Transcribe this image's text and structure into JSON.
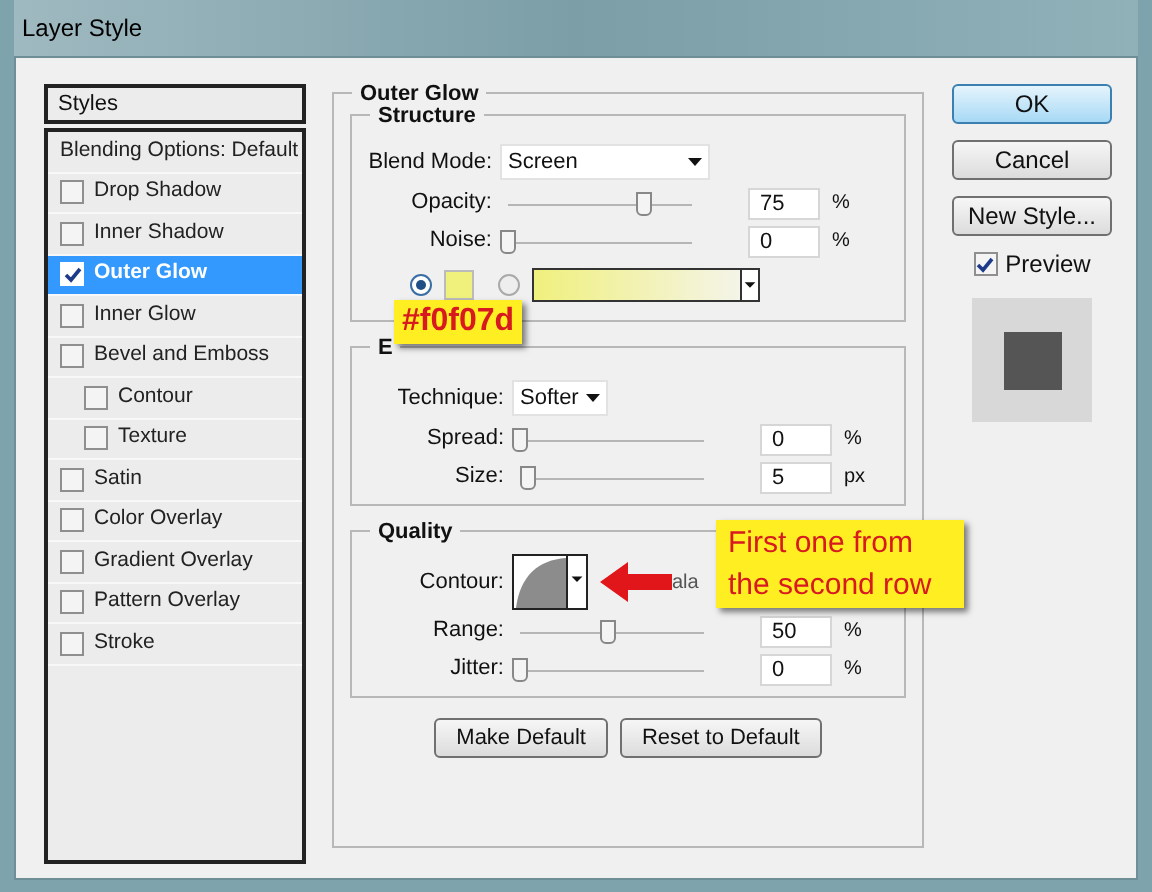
{
  "window": {
    "title": "Layer Style"
  },
  "styles_panel": {
    "header": "Styles",
    "items": [
      {
        "label": "Blending Options: Default",
        "kind": "plain",
        "selected": false
      },
      {
        "label": "Drop Shadow",
        "kind": "checkbox",
        "checked": false,
        "selected": false
      },
      {
        "label": "Inner Shadow",
        "kind": "checkbox",
        "checked": false,
        "selected": false
      },
      {
        "label": "Outer Glow",
        "kind": "checkbox",
        "checked": true,
        "selected": true
      },
      {
        "label": "Inner Glow",
        "kind": "checkbox",
        "checked": false,
        "selected": false
      },
      {
        "label": "Bevel and Emboss",
        "kind": "checkbox",
        "checked": false,
        "selected": false,
        "children": [
          {
            "label": "Contour",
            "kind": "checkbox",
            "checked": false,
            "selected": false
          },
          {
            "label": "Texture",
            "kind": "checkbox",
            "checked": false,
            "selected": false
          }
        ]
      },
      {
        "label": "Satin",
        "kind": "checkbox",
        "checked": false,
        "selected": false
      },
      {
        "label": "Color Overlay",
        "kind": "checkbox",
        "checked": false,
        "selected": false
      },
      {
        "label": "Gradient Overlay",
        "kind": "checkbox",
        "checked": false,
        "selected": false
      },
      {
        "label": "Pattern Overlay",
        "kind": "checkbox",
        "checked": false,
        "selected": false
      },
      {
        "label": "Stroke",
        "kind": "checkbox",
        "checked": false,
        "selected": false
      }
    ]
  },
  "outer_glow": {
    "title": "Outer Glow",
    "structure": {
      "title": "Structure",
      "blend_mode": {
        "label": "Blend Mode:",
        "value": "Screen"
      },
      "sliders": [
        {
          "label": "Opacity:",
          "level": 0.77,
          "value": "75",
          "unit": "%"
        },
        {
          "label": "Noise:",
          "level": 0,
          "value": "0",
          "unit": "%"
        }
      ],
      "color_choice": [
        {
          "kind": "solid",
          "selected": true,
          "color": "#f0f07d"
        },
        {
          "kind": "gradient",
          "selected": false,
          "color": "#f0f07d"
        }
      ]
    },
    "elements": {
      "title": "E",
      "technique": {
        "label": "Technique:",
        "value": "Softer"
      },
      "sliders": [
        {
          "label": "Spread:",
          "level": 0,
          "value": "0",
          "unit": "%"
        },
        {
          "label": "Size:",
          "level": 0.05,
          "value": "5",
          "unit": "px"
        }
      ]
    },
    "quality": {
      "title": "Quality",
      "contour_label": "Contour:",
      "anti_alias_fragment": "ala",
      "sliders": [
        {
          "label": "Range:",
          "level": 0.5,
          "value": "50",
          "unit": "%"
        },
        {
          "label": "Jitter:",
          "level": 0,
          "value": "0",
          "unit": "%"
        }
      ]
    },
    "buttons": [
      "Make Default",
      "Reset to Default"
    ]
  },
  "side_buttons": [
    {
      "label": "OK",
      "kind": "default"
    },
    {
      "label": "Cancel",
      "kind": "normal"
    },
    {
      "label": "New Style...",
      "kind": "normal"
    }
  ],
  "preview": {
    "label": "Preview",
    "checked": true
  },
  "annotations": {
    "color_label": "#f0f07d",
    "callout": "First one from the second row"
  }
}
